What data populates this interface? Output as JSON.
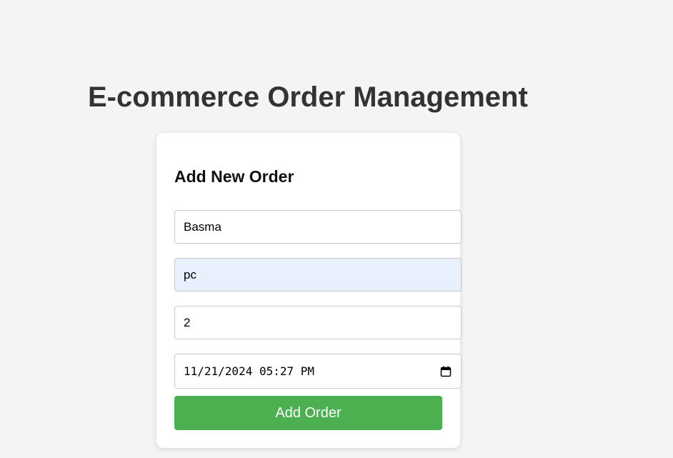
{
  "page": {
    "title": "E-commerce Order Management"
  },
  "form": {
    "title": "Add New Order",
    "customer_name": {
      "value": "Basma"
    },
    "product": {
      "value": "pc"
    },
    "quantity": {
      "value": "2"
    },
    "order_datetime": {
      "value": "11/21/2024 05:27 PM",
      "icon": "calendar-icon"
    },
    "submit_label": "Add Order"
  },
  "colors": {
    "background": "#f4f4f4",
    "card": "#ffffff",
    "title_text": "#333333",
    "button": "#4caf50",
    "button_text": "#ffffff",
    "autofill_background": "#e8f0fe",
    "input_border": "#c8c8c8"
  }
}
